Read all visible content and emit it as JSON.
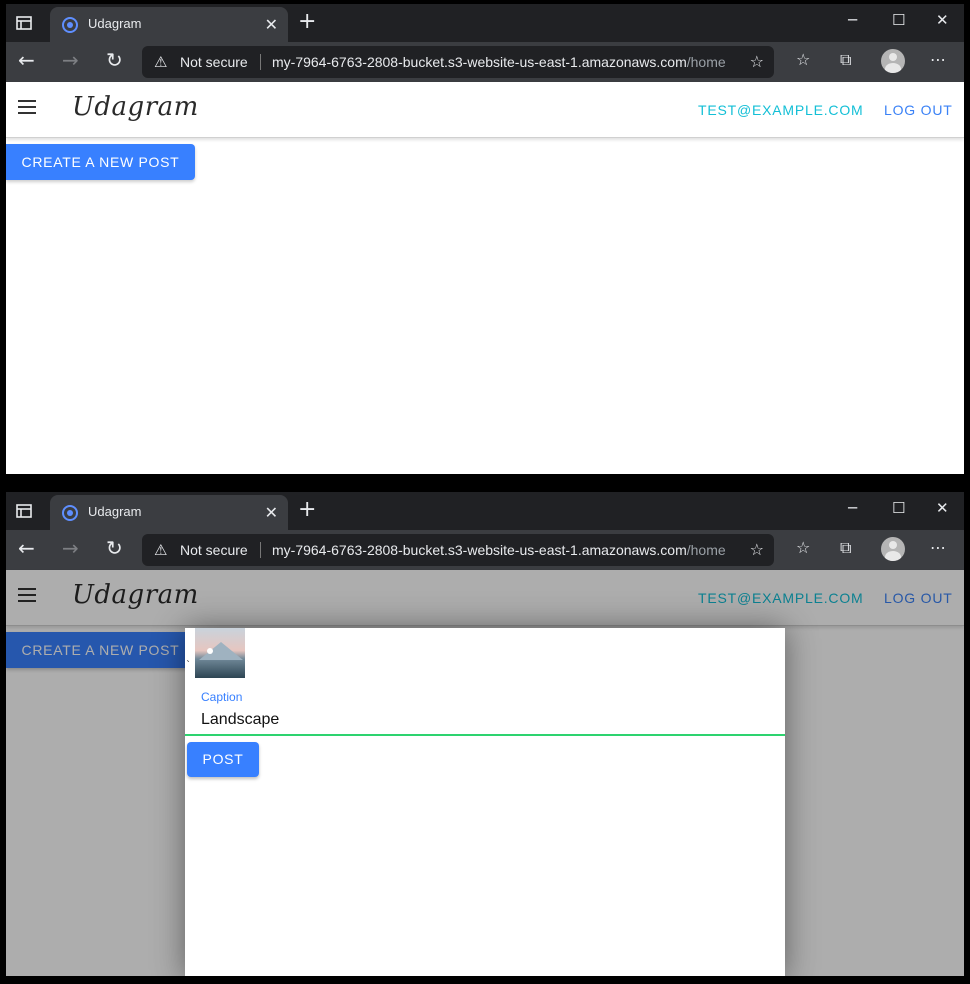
{
  "browser": {
    "tab_title": "Udagram",
    "tab_close": "✕",
    "new_tab": "+",
    "minimize": "─",
    "maximize": "☐",
    "close": "✕",
    "security_label": "Not secure",
    "url_host": "my-7964-6763-2808-bucket.s3-website-us-east-1.amazonaws.com",
    "url_path": "/home",
    "icons": [
      "back-icon",
      "forward-icon",
      "refresh-icon",
      "warning-icon",
      "add-favorite-icon",
      "favorites-icon",
      "collections-icon",
      "profile-icon",
      "more-icon"
    ]
  },
  "app": {
    "logo": "Udagram",
    "user_email": "TEST@EXAMPLE.COM",
    "logout": "LOG OUT",
    "create_post": "CREATE A NEW POST"
  },
  "modal": {
    "tick": "`",
    "caption_label": "Caption",
    "caption_value": "Landscape",
    "post_button": "POST"
  },
  "colors": {
    "primary": "#3880ff",
    "email": "#13bfd6",
    "success_underline": "#2dd36f",
    "browser_dark": "#202124",
    "browser_toolbar": "#3b3d41"
  }
}
